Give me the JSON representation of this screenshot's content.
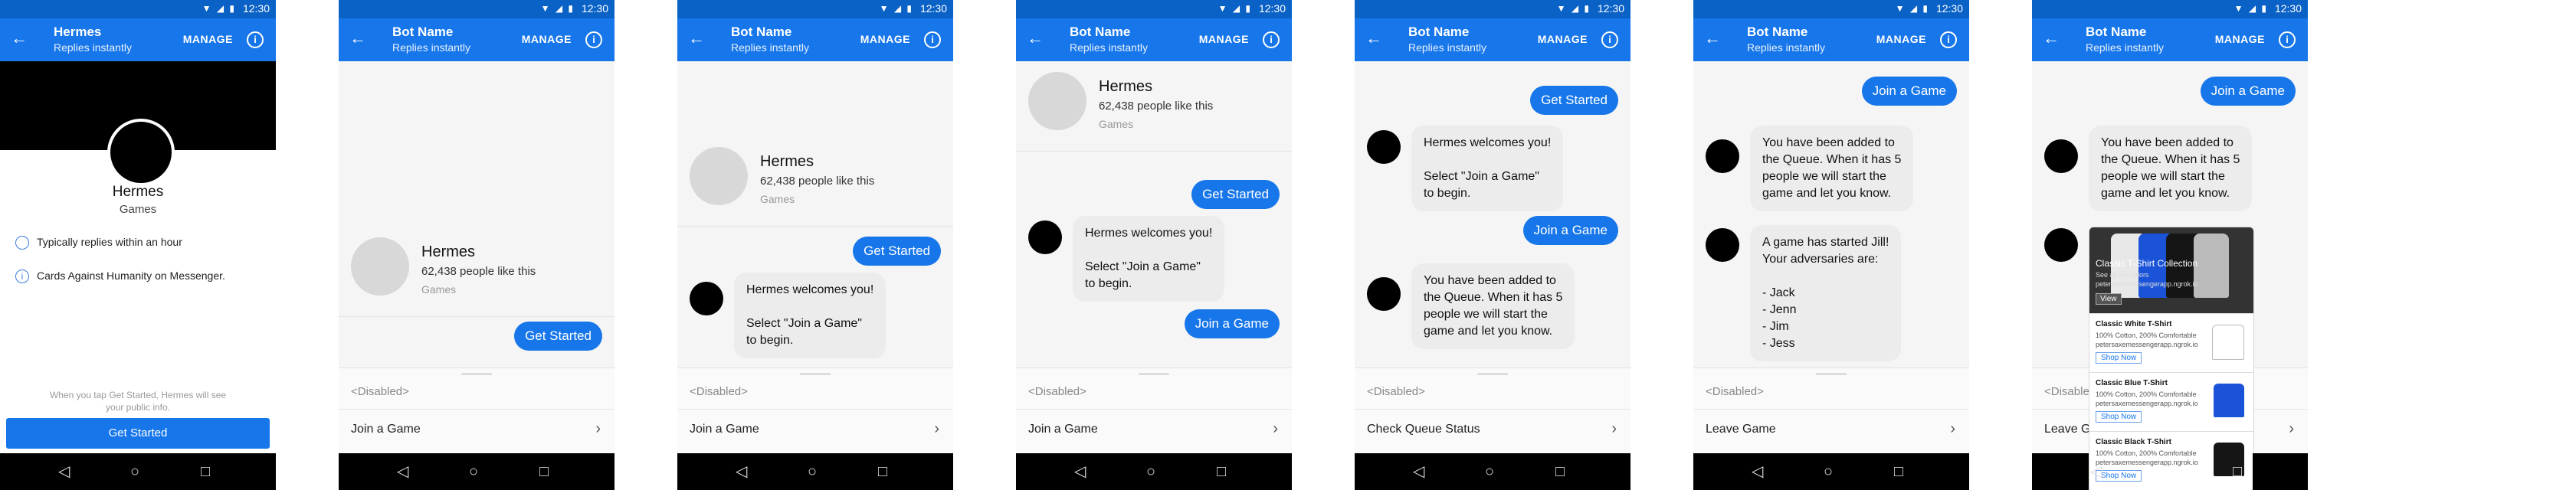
{
  "status": {
    "time": "12:30",
    "icons": "▼ ◢ ▮"
  },
  "nav": {
    "back": "◁",
    "home": "○",
    "recent": "□"
  },
  "common": {
    "manage": "MANAGE",
    "subtitle": "Replies instantly",
    "disabled": "<Disabled>",
    "arrow": "›",
    "back_icon": "←",
    "info_icon": "i",
    "page_name": "Hermes",
    "likes": "62,438 people like this",
    "category": "Games",
    "get_started": "Get Started",
    "join_a_game": "Join a Game",
    "welcome": "Hermes welcomes you!\n\nSelect \"Join a Game\"\nto begin.",
    "queue": "You have been added to\nthe Queue. When it has 5\npeople we will start the\ngame and let you know.",
    "started": "A game has started Jill!\nYour adversaries are:\n\n- Jack\n- Jenn\n- Jim\n- Jess"
  },
  "screens": [
    {
      "title": "Hermes",
      "menu": ""
    },
    {
      "title": "Bot Name",
      "menu": "Join a Game"
    },
    {
      "title": "Bot Name",
      "menu": "Join a Game"
    },
    {
      "title": "Bot Name",
      "menu": "Join a Game"
    },
    {
      "title": "Bot Name",
      "menu": "Check Queue Status"
    },
    {
      "title": "Bot Name",
      "menu": "Leave Game"
    },
    {
      "title": "Bot Name",
      "menu": "Leave G"
    }
  ],
  "profile": {
    "name": "Hermes",
    "category": "Games",
    "reply_time": "Typically replies within an hour",
    "about": "Cards Against Humanity on Messenger.",
    "note": "When you tap Get Started, Hermes will see\nyour public info.",
    "button": "Get Started"
  },
  "shop": {
    "header_title": "Classic T-Shirt Collection",
    "header_sub": "See all our colors\npetersaxemessengerapp.ngrok.io",
    "header_btn": "View",
    "shop_now": "Shop Now",
    "items": [
      {
        "title": "Classic White T-Shirt",
        "sub": "100% Cotton, 200% Comfortable\npetersaxemessengerapp.ngrok.io",
        "color": "#ffffff"
      },
      {
        "title": "Classic Blue T-Shirt",
        "sub": "100% Cotton, 200% Comfortable\npetersaxemessengerapp.ngrok.io",
        "color": "#1a53d8"
      },
      {
        "title": "Classic Black T-Shirt",
        "sub": "100% Cotton, 200% Comfortable\npetersaxemessengerapp.ngrok.io",
        "color": "#151515"
      }
    ]
  },
  "colors": {
    "brand": "#1676ea",
    "statusbar": "#0a62c6",
    "bubble_in": "#ececec"
  }
}
